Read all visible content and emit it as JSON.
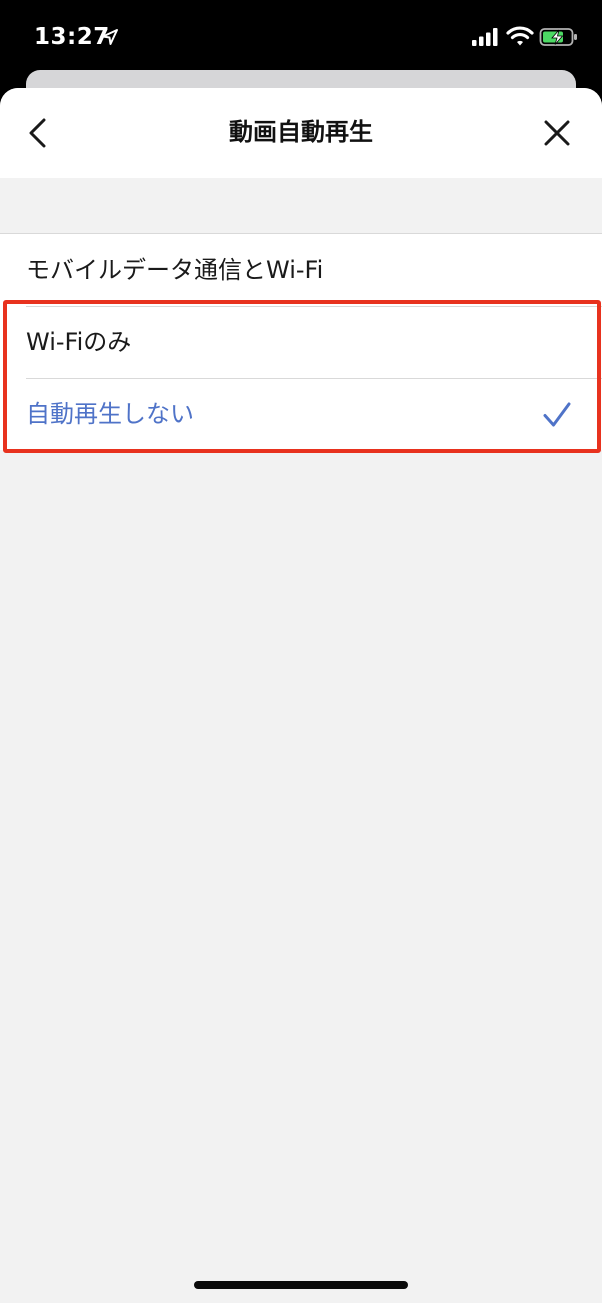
{
  "status_bar": {
    "time": "13:27",
    "icons": [
      "location-arrow-icon",
      "cellular-signal-icon",
      "wifi-icon",
      "battery-charging-icon"
    ],
    "battery_color": "#4cd964"
  },
  "header": {
    "title": "動画自動再生",
    "back_icon": "chevron-left-icon",
    "close_icon": "close-icon"
  },
  "options": [
    {
      "label": "モバイルデータ通信とWi-Fi",
      "selected": false
    },
    {
      "label": "Wi-Fiのみ",
      "selected": false
    },
    {
      "label": "自動再生しない",
      "selected": true
    }
  ],
  "colors": {
    "accent": "#4f73c8",
    "highlight": "#e8321e",
    "sheet_background": "#f2f2f2"
  }
}
